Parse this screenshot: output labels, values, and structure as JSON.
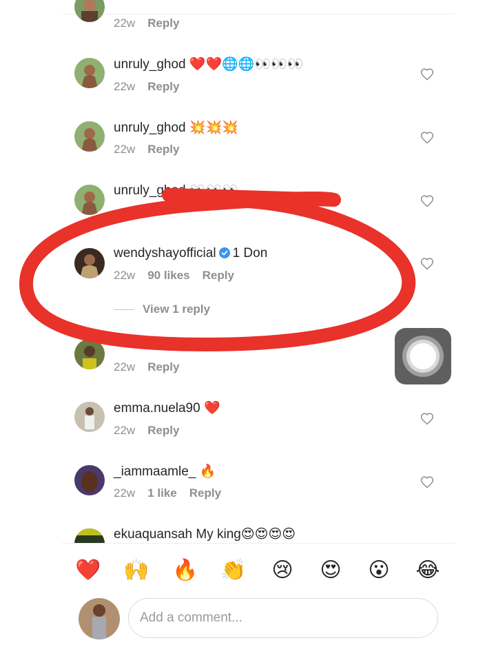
{
  "comments": [
    {
      "username": "",
      "text": "",
      "age": "22w",
      "likes": "",
      "reply": "Reply"
    },
    {
      "username": "unruly_ghod",
      "text": "❤️❤️🌐🌐👀👀👀",
      "age": "22w",
      "likes": "",
      "reply": "Reply"
    },
    {
      "username": "unruly_ghod",
      "text": "💥💥💥",
      "age": "22w",
      "likes": "",
      "reply": "Reply"
    },
    {
      "username": "unruly_ghod",
      "text": "👀👀👀",
      "age": "",
      "likes": "",
      "reply": ""
    },
    {
      "username": "wendyshayofficial",
      "verified": true,
      "text": "1 Don",
      "age": "22w",
      "likes": "90 likes",
      "reply": "Reply",
      "view_replies": "View 1 reply"
    },
    {
      "username": "",
      "text": "",
      "age": "22w",
      "likes": "",
      "reply": "Reply"
    },
    {
      "username": "emma.nuela90",
      "text": "❤️",
      "age": "22w",
      "likes": "",
      "reply": "Reply"
    },
    {
      "username": "_iammaamle_",
      "text": "🔥",
      "age": "22w",
      "likes": "1 like",
      "reply": "Reply"
    },
    {
      "username": "ekuaquansah",
      "text": "My king😍😍😍😍",
      "age": "",
      "likes": "",
      "reply": ""
    }
  ],
  "emoji_bar": [
    "❤️",
    "🙌",
    "🔥",
    "👏",
    "😢",
    "😍",
    "😮",
    "😂"
  ],
  "composer": {
    "placeholder": "Add a comment..."
  },
  "icons": {
    "like": "heart-outline-icon",
    "verified": "verified-badge-icon",
    "assistive_touch": "assistive-touch-icon"
  },
  "colors": {
    "annotation": "#e8322a",
    "verified": "#3897f0",
    "meta_text": "#8e8e8e"
  }
}
